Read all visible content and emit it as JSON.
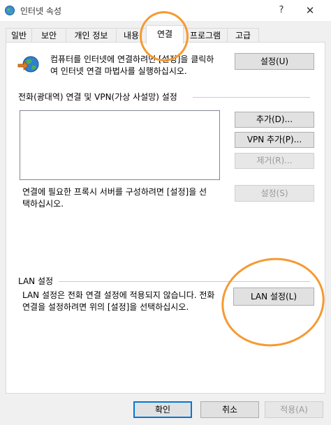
{
  "window": {
    "title": "인터넷 속성",
    "help": "?",
    "close": "✕"
  },
  "tabs": [
    {
      "label": "일반"
    },
    {
      "label": "보안"
    },
    {
      "label": "개인 정보"
    },
    {
      "label": "내용"
    },
    {
      "label": "연결",
      "active": true
    },
    {
      "label": "프로그램"
    },
    {
      "label": "고급"
    }
  ],
  "setup": {
    "text_line1": "컴퓨터를 인터넷에 연결하려면 [설정]을 클릭하",
    "text_line2": "여 인터넷 연결 마법사를 실행하십시오.",
    "button": "설정(U)"
  },
  "dialup": {
    "heading": "전화(광대역) 연결 및 VPN(가상 사설망) 설정",
    "add_button": "추가(D)...",
    "add_vpn_button": "VPN 추가(P)...",
    "remove_button": "제거(R)...",
    "proxy_text_line1": "연결에 필요한 프록시 서버를 구성하려면 [설정]을 선",
    "proxy_text_line2": "택하십시오.",
    "settings_button": "설정(S)"
  },
  "lan": {
    "heading": "LAN 설정",
    "text_line1": "LAN 설정은 전화 연결 설정에 적용되지 않습니다. 전화",
    "text_line2": "연결을 설정하려면 위의 [설정]을 선택하십시오.",
    "button": "LAN 설정(L)"
  },
  "footer": {
    "ok": "확인",
    "cancel": "취소",
    "apply": "적용(A)"
  },
  "colors": {
    "annotation": "#f59a32",
    "focus": "#0078d7"
  }
}
